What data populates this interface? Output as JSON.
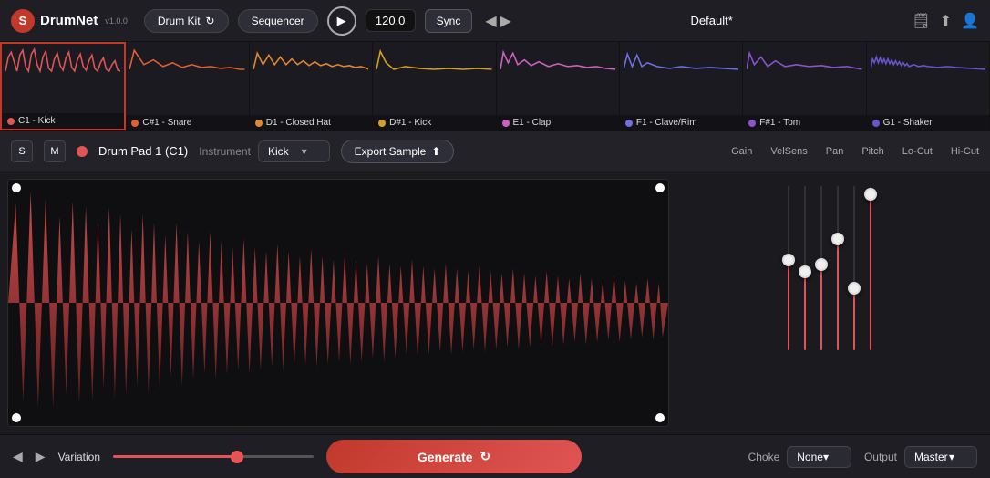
{
  "header": {
    "logo_letter": "S",
    "app_name": "DrumNet",
    "version": "v1.0.0",
    "drum_kit_label": "Drum Kit",
    "sequencer_label": "Sequencer",
    "bpm": "120.0",
    "sync_label": "Sync",
    "preset_name": "Default*",
    "icons": [
      "save",
      "export",
      "user"
    ]
  },
  "drum_pads": [
    {
      "id": "pad-c1",
      "note": "C1",
      "name": "Kick",
      "color": "#e05555",
      "active": true
    },
    {
      "id": "pad-c1#",
      "note": "C#1",
      "name": "Snare",
      "color": "#e06030",
      "active": false
    },
    {
      "id": "pad-d1",
      "note": "D1",
      "name": "Closed Hat",
      "color": "#e08830",
      "active": false
    },
    {
      "id": "pad-d1#",
      "note": "D#1",
      "name": "Kick",
      "color": "#d4a020",
      "active": false
    },
    {
      "id": "pad-e1",
      "note": "E1",
      "name": "Clap",
      "color": "#d060c0",
      "active": false
    },
    {
      "id": "pad-f1",
      "note": "F1",
      "name": "Clave/Rim",
      "color": "#7070e0",
      "active": false
    },
    {
      "id": "pad-f1#",
      "note": "F#1",
      "name": "Tom",
      "color": "#8855cc",
      "active": false
    },
    {
      "id": "pad-g1",
      "note": "G1",
      "name": "Shaker",
      "color": "#6655cc",
      "active": false
    }
  ],
  "instrument_bar": {
    "s_label": "S",
    "m_label": "M",
    "pad_title": "Drum Pad 1 (C1)",
    "instrument_label": "Instrument",
    "instrument_value": "Kick",
    "export_sample_label": "Export Sample",
    "knob_labels": [
      "Gain",
      "VelSens",
      "Pan",
      "Pitch",
      "Lo-Cut",
      "Hi-Cut"
    ]
  },
  "sliders": {
    "gain": {
      "pct": 55
    },
    "velsens": {
      "pct": 48
    },
    "pan": {
      "pct": 52
    },
    "pitch": {
      "pct": 68
    },
    "lo_cut": {
      "pct": 38
    },
    "hi_cut": {
      "pct": 95
    }
  },
  "bottom_bar": {
    "variation_label": "Variation",
    "generate_label": "Generate",
    "choke_label": "Choke",
    "choke_value": "None",
    "output_label": "Output",
    "output_value": "Master"
  }
}
